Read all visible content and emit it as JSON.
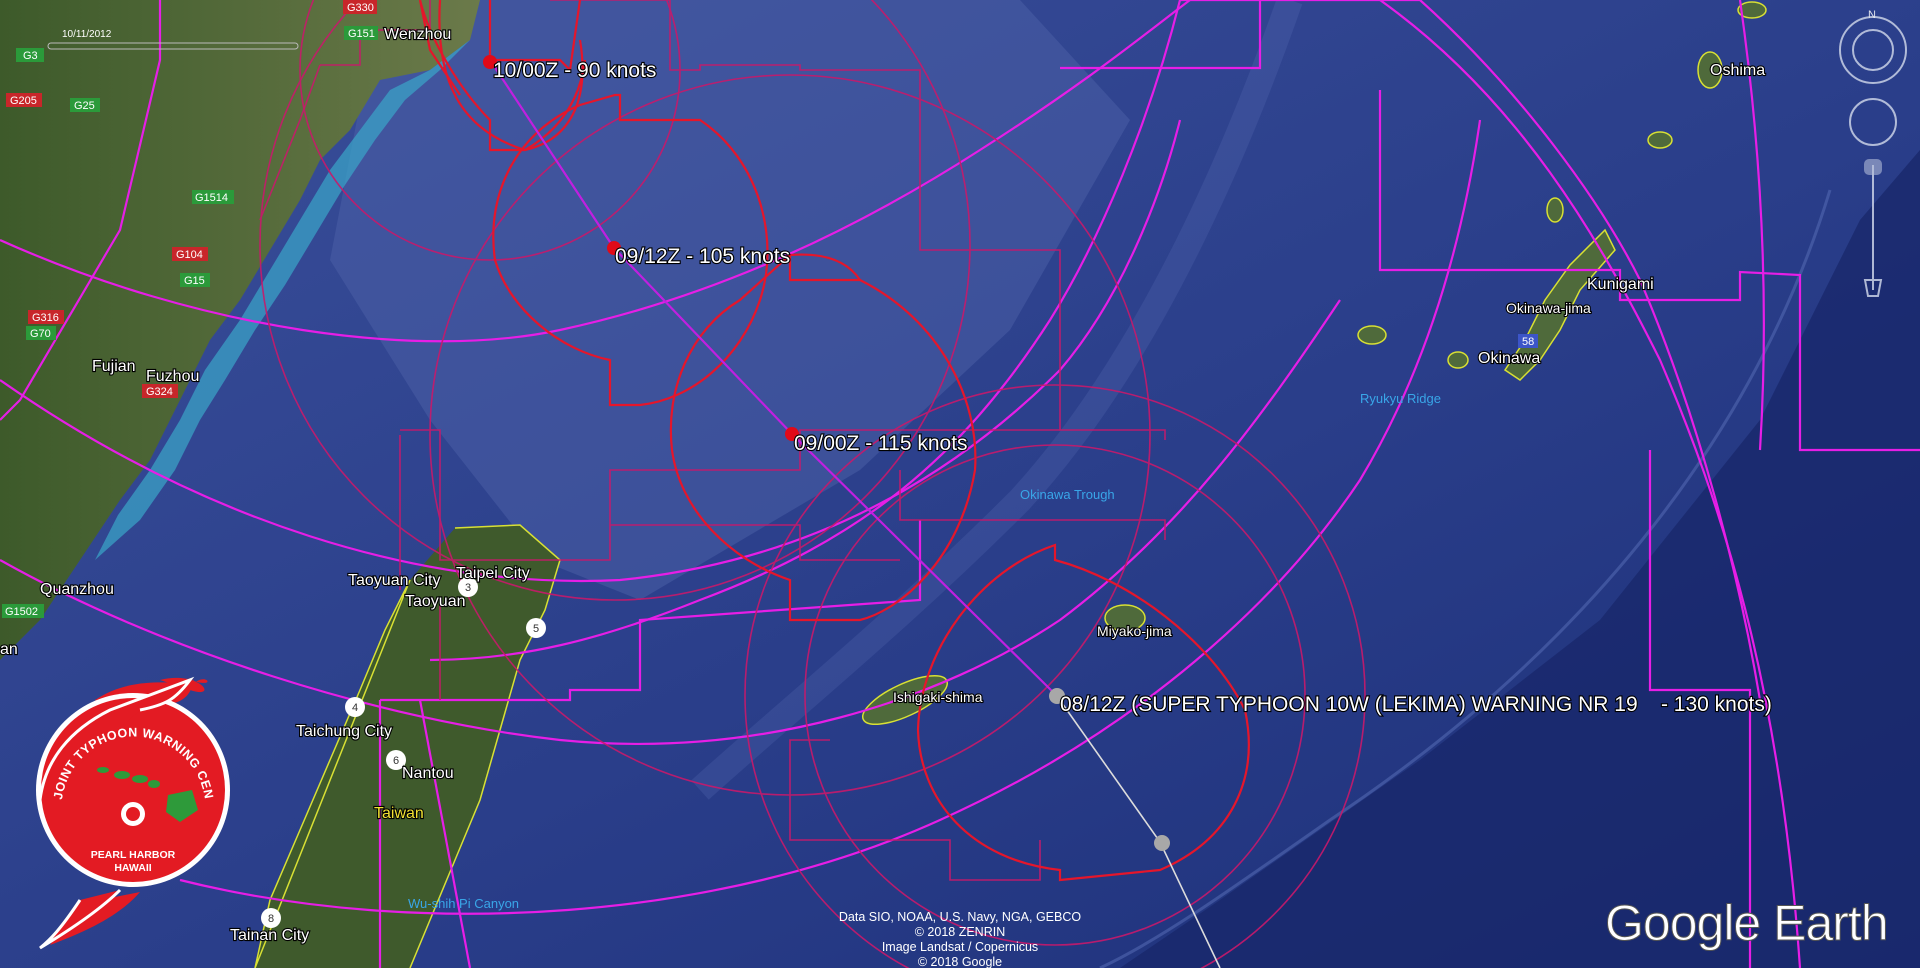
{
  "date_label": "10/11/2012",
  "track_labels": [
    {
      "id": "fix-10-00z",
      "text": "10/00Z - 90 knots"
    },
    {
      "id": "fix-09-12z",
      "text": "09/12Z - 105 knots"
    },
    {
      "id": "fix-09-00z",
      "text": "09/00Z - 115 knots"
    },
    {
      "id": "fix-08-12z",
      "text": "08/12Z (SUPER TYPHOON 10W (LEKIMA) WARNING NR 19    - 130 knots)"
    }
  ],
  "places": {
    "wenzhou": "Wenzhou",
    "fujian": "Fujian",
    "fuzhou": "Fuzhou",
    "quanzhou": "Quanzhou",
    "taoyuan_city": "Taoyuan City",
    "taipei_city": "Taipei City",
    "taoyuan": "Taoyuan",
    "taichung_city": "Taichung City",
    "nantou": "Nantou",
    "taiwan": "Taiwan",
    "tainan_city": "Tainan City",
    "ishigaki": "Ishigaki-shima",
    "miyako": "Miyako-jima",
    "oshima": "Oshima",
    "kunigami": "Kunigami",
    "okinawa_jima": "Okinawa-jima",
    "okinawa": "Okinawa",
    "edge_an": "an"
  },
  "features": {
    "okinawa_trough": "Okinawa Trough",
    "ryukyu_ridge": "Ryukyu Ridge",
    "wushih_canyon": "Wu-shih Pi Canyon"
  },
  "roads": [
    "G330",
    "G151",
    "G3",
    "G205",
    "G25",
    "G1514",
    "G104",
    "G15",
    "G316",
    "G70",
    "G324",
    "G1502",
    "58"
  ],
  "road_markers": [
    "3",
    "5",
    "4",
    "6",
    "8"
  ],
  "colors": {
    "ocean": "#2c3f86",
    "forecast_circle": "#e5162b",
    "wind_radius": "#c8196b",
    "danger_area": "#e61ee6",
    "track": "#c020e0",
    "past_track": "#d8d8d8"
  },
  "logo": {
    "top_text": "JOINT TYPHOON WARNING CENTER",
    "line1": "PEARL HARBOR",
    "line2": "HAWAII",
    "colors": {
      "red": "#e31b23",
      "green": "#2e9a3a"
    }
  },
  "credits": [
    "Data SIO, NOAA, U.S. Navy, NGA, GEBCO",
    "© 2018 ZENRIN",
    "Image Landsat / Copernicus",
    "© 2018 Google"
  ],
  "brand": "Google Earth",
  "compass": {
    "north": "N"
  },
  "icons": [
    "compass-icon",
    "look-joystick-icon",
    "zoom-slider-icon",
    "typhoon-logo-icon"
  ]
}
